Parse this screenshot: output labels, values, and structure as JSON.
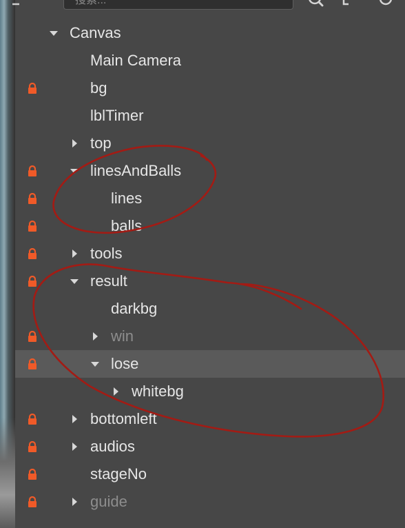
{
  "search": {
    "placeholder": "搜索..."
  },
  "toolbar": {
    "icons": [
      "search-icon",
      "expand-icon",
      "refresh-icon"
    ]
  },
  "tree": {
    "nodes": [
      {
        "label": "Canvas",
        "locked": false,
        "arrow": "down",
        "depth": 0,
        "dim": false,
        "selected": false
      },
      {
        "label": "Main Camera",
        "locked": false,
        "arrow": "none",
        "depth": 1,
        "dim": false,
        "selected": false
      },
      {
        "label": "bg",
        "locked": true,
        "arrow": "none",
        "depth": 1,
        "dim": false,
        "selected": false
      },
      {
        "label": "lblTimer",
        "locked": false,
        "arrow": "none",
        "depth": 1,
        "dim": false,
        "selected": false
      },
      {
        "label": "top",
        "locked": false,
        "arrow": "right",
        "depth": 1,
        "dim": false,
        "selected": false
      },
      {
        "label": "linesAndBalls",
        "locked": true,
        "arrow": "down",
        "depth": 1,
        "dim": false,
        "selected": false
      },
      {
        "label": "lines",
        "locked": true,
        "arrow": "none",
        "depth": 2,
        "dim": false,
        "selected": false
      },
      {
        "label": "balls",
        "locked": true,
        "arrow": "none",
        "depth": 2,
        "dim": false,
        "selected": false
      },
      {
        "label": "tools",
        "locked": true,
        "arrow": "right",
        "depth": 1,
        "dim": false,
        "selected": false
      },
      {
        "label": "result",
        "locked": true,
        "arrow": "down",
        "depth": 1,
        "dim": false,
        "selected": false
      },
      {
        "label": "darkbg",
        "locked": false,
        "arrow": "none",
        "depth": 2,
        "dim": false,
        "selected": false
      },
      {
        "label": "win",
        "locked": true,
        "arrow": "right",
        "depth": 2,
        "dim": true,
        "selected": false
      },
      {
        "label": "lose",
        "locked": true,
        "arrow": "down",
        "depth": 2,
        "dim": false,
        "selected": true
      },
      {
        "label": "whitebg",
        "locked": false,
        "arrow": "right",
        "depth": 3,
        "dim": false,
        "selected": false
      },
      {
        "label": "bottomleft",
        "locked": true,
        "arrow": "right",
        "depth": 1,
        "dim": false,
        "selected": false
      },
      {
        "label": "audios",
        "locked": true,
        "arrow": "right",
        "depth": 1,
        "dim": false,
        "selected": false
      },
      {
        "label": "stageNo",
        "locked": true,
        "arrow": "none",
        "depth": 1,
        "dim": false,
        "selected": false
      },
      {
        "label": "guide",
        "locked": true,
        "arrow": "right",
        "depth": 1,
        "dim": true,
        "selected": false
      }
    ]
  },
  "colors": {
    "background": "#474747",
    "text": "#e6e6e6",
    "text_dim": "#8d8d8d",
    "lock": "#f05a28",
    "selected_row": "#5a5a5a",
    "annotation": "#a31b14"
  },
  "annotations": [
    "red-ellipse-linesandballs",
    "red-ellipse-result"
  ]
}
